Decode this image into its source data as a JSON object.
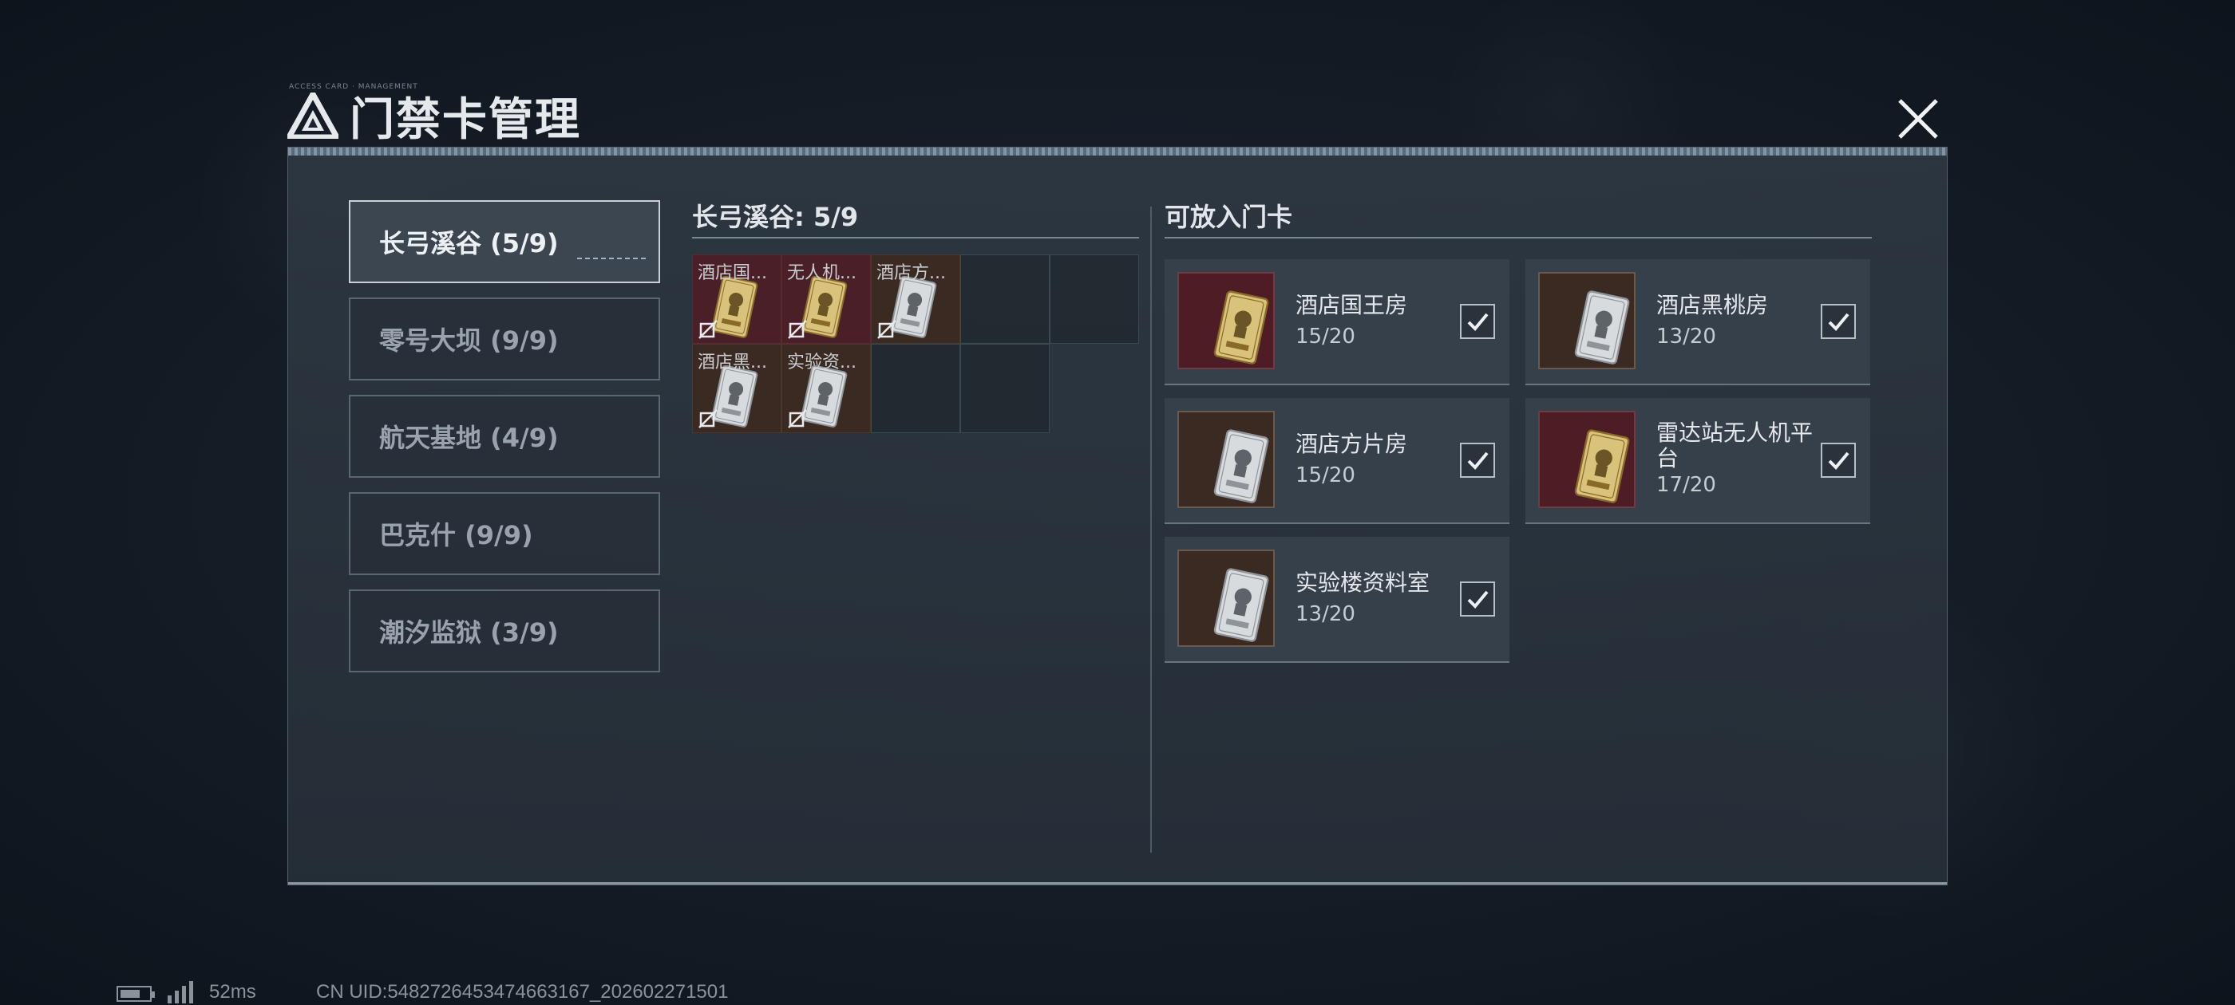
{
  "title": "门禁卡管理",
  "title_deco": "ACCESS CARD · MANAGEMENT",
  "tabs": [
    {
      "label": "长弓溪谷 (5/9)",
      "active": true
    },
    {
      "label": "零号大坝 (9/9)",
      "active": false
    },
    {
      "label": "航天基地 (4/9)",
      "active": false
    },
    {
      "label": "巴克什 (9/9)",
      "active": false
    },
    {
      "label": "潮汐监狱 (3/9)",
      "active": false
    }
  ],
  "slots_section": {
    "title": "长弓溪谷: 5/9",
    "slots": [
      {
        "label": "酒店国...",
        "color": "red",
        "card": "gold"
      },
      {
        "label": "无人机...",
        "color": "red",
        "card": "gold"
      },
      {
        "label": "酒店方...",
        "color": "brown",
        "card": "silver"
      },
      {
        "label": "",
        "color": "empty",
        "card": ""
      },
      {
        "label": "",
        "color": "empty",
        "card": ""
      },
      {
        "label": "酒店黑...",
        "color": "brown",
        "card": "silver"
      },
      {
        "label": "实验资...",
        "color": "brown",
        "card": "silver"
      },
      {
        "label": "",
        "color": "empty",
        "card": ""
      },
      {
        "label": "",
        "color": "empty",
        "card": ""
      }
    ]
  },
  "available_section": {
    "title": "可放入门卡",
    "cards": [
      {
        "name": "酒店国王房",
        "count": "15/20",
        "color": "red",
        "card": "gold",
        "checked": true
      },
      {
        "name": "酒店黑桃房",
        "count": "13/20",
        "color": "brown",
        "card": "silver",
        "checked": true
      },
      {
        "name": "酒店方片房",
        "count": "15/20",
        "color": "brown",
        "card": "silver",
        "checked": true
      },
      {
        "name": "雷达站无人机平台",
        "count": "17/20",
        "color": "red",
        "card": "gold",
        "checked": true
      },
      {
        "name": "实验楼资料室",
        "count": "13/20",
        "color": "brown",
        "card": "silver",
        "checked": true
      }
    ]
  },
  "status_bar": {
    "ping": "52ms",
    "uid": "CN UID:5482726453474663167_202602271501"
  },
  "icons": {
    "logo": "triangle-logo-icon",
    "close": "close-icon",
    "card": "access-card-icon",
    "unbind": "unbind-icon",
    "check": "checkmark-icon"
  }
}
